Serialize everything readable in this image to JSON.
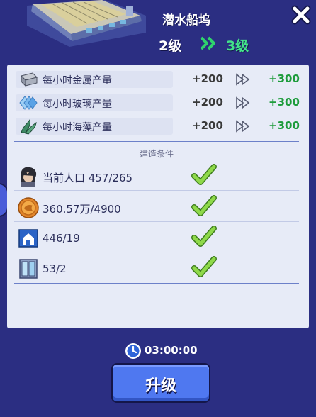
{
  "header": {
    "title": "潜水船坞",
    "level_from": "2级",
    "level_to": "3级"
  },
  "production": [
    {
      "icon": "metal-icon",
      "label": "每小时金属产量",
      "current": "+200",
      "next": "+300"
    },
    {
      "icon": "glass-icon",
      "label": "每小时玻璃产量",
      "current": "+200",
      "next": "+300"
    },
    {
      "icon": "seaweed-icon",
      "label": "每小时海藻产量",
      "current": "+200",
      "next": "+300"
    }
  ],
  "conditions": {
    "title": "建造条件",
    "items": [
      {
        "icon": "population-icon",
        "text": "当前人口 457/265",
        "met": true
      },
      {
        "icon": "coin-icon",
        "text": "360.57万/4900",
        "met": true
      },
      {
        "icon": "house-icon",
        "text": "446/19",
        "met": true
      },
      {
        "icon": "window-icon",
        "text": "53/2",
        "met": true
      }
    ]
  },
  "timer": {
    "text": "03:00:00"
  },
  "upgrade_button": {
    "label": "升级"
  },
  "colors": {
    "background": "#2b2e82",
    "card": "#e7ebf7",
    "next_value": "#1e9c3c",
    "level_to": "#43e38a",
    "button": "#4f78f0"
  }
}
